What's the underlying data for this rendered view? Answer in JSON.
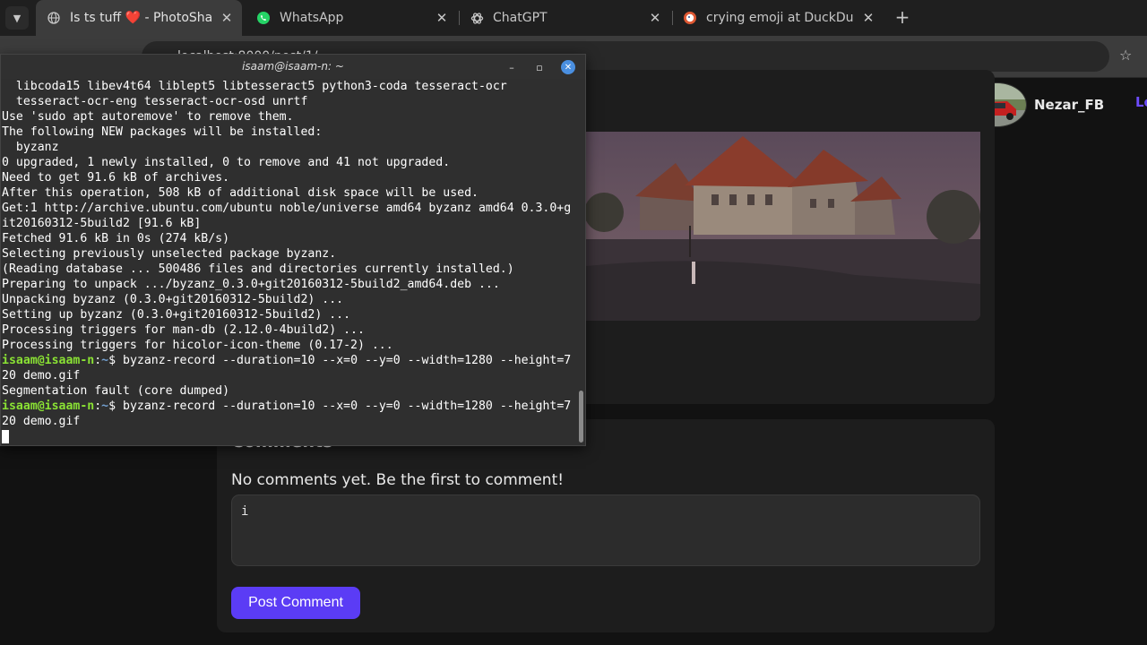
{
  "browser": {
    "tabs": [
      {
        "title": "Is ts tuff ❤️ - PhotoShare",
        "active": true,
        "favicon": "globe-icon"
      },
      {
        "title": "WhatsApp",
        "active": false,
        "favicon": "whatsapp-icon"
      },
      {
        "title": "ChatGPT",
        "active": false,
        "favicon": "chatgpt-icon"
      },
      {
        "title": "crying emoji at DuckDuckGo",
        "active": false,
        "favicon": "duckduckgo-icon"
      }
    ],
    "address": "localhost:8000/post/1/",
    "colors": {
      "tabbar": "#1f1f1f",
      "toolbar": "#3c3c3c",
      "omnibox": "#282828"
    }
  },
  "page": {
    "username": "Nezar_FB",
    "nav_link_partial": "Lo",
    "comments_heading": "Comments",
    "no_comments_text": "No comments yet. Be the first to comment!",
    "comment_input_value": "i",
    "post_comment_label": "Post Comment",
    "colors": {
      "accent": "#5b3cf5",
      "background": "#121212",
      "card": "#1d1d1d"
    }
  },
  "terminal": {
    "title": "isaam@isaam-n: ~",
    "prompt_user": "isaam@isaam-n",
    "prompt_path": "~",
    "lines": [
      {
        "text": "  libcoda15 libev4t64 liblept5 libtesseract5 python3-coda tesseract-ocr"
      },
      {
        "text": "  tesseract-ocr-eng tesseract-ocr-osd unrtf"
      },
      {
        "text": "Use 'sudo apt autoremove' to remove them."
      },
      {
        "text": "The following NEW packages will be installed:"
      },
      {
        "text": "  byzanz"
      },
      {
        "text": "0 upgraded, 1 newly installed, 0 to remove and 41 not upgraded."
      },
      {
        "text": "Need to get 91.6 kB of archives."
      },
      {
        "text": "After this operation, 508 kB of additional disk space will be used."
      },
      {
        "text": "Get:1 http://archive.ubuntu.com/ubuntu noble/universe amd64 byzanz amd64 0.3.0+g"
      },
      {
        "text": "it20160312-5build2 [91.6 kB]"
      },
      {
        "text": "Fetched 91.6 kB in 0s (274 kB/s)"
      },
      {
        "text": "Selecting previously unselected package byzanz."
      },
      {
        "text": "(Reading database ... 500486 files and directories currently installed.)"
      },
      {
        "text": "Preparing to unpack .../byzanz_0.3.0+git20160312-5build2_amd64.deb ..."
      },
      {
        "text": "Unpacking byzanz (0.3.0+git20160312-5build2) ..."
      },
      {
        "text": "Setting up byzanz (0.3.0+git20160312-5build2) ..."
      },
      {
        "text": "Processing triggers for man-db (2.12.0-4build2) ..."
      },
      {
        "text": "Processing triggers for hicolor-icon-theme (0.17-2) ..."
      },
      {
        "prompt": true,
        "text": " byzanz-record --duration=10 --x=0 --y=0 --width=1280 --height=7"
      },
      {
        "text": "20 demo.gif"
      },
      {
        "text": "Segmentation fault (core dumped)"
      },
      {
        "prompt": true,
        "text": " byzanz-record --duration=10 --x=0 --y=0 --width=1280 --height=7"
      },
      {
        "text": "20 demo.gif"
      },
      {
        "cursor": true,
        "text": ""
      }
    ],
    "colors": {
      "background": "#2f2f2f",
      "prompt_user": "#8ae234",
      "prompt_path": "#729fcf"
    }
  }
}
